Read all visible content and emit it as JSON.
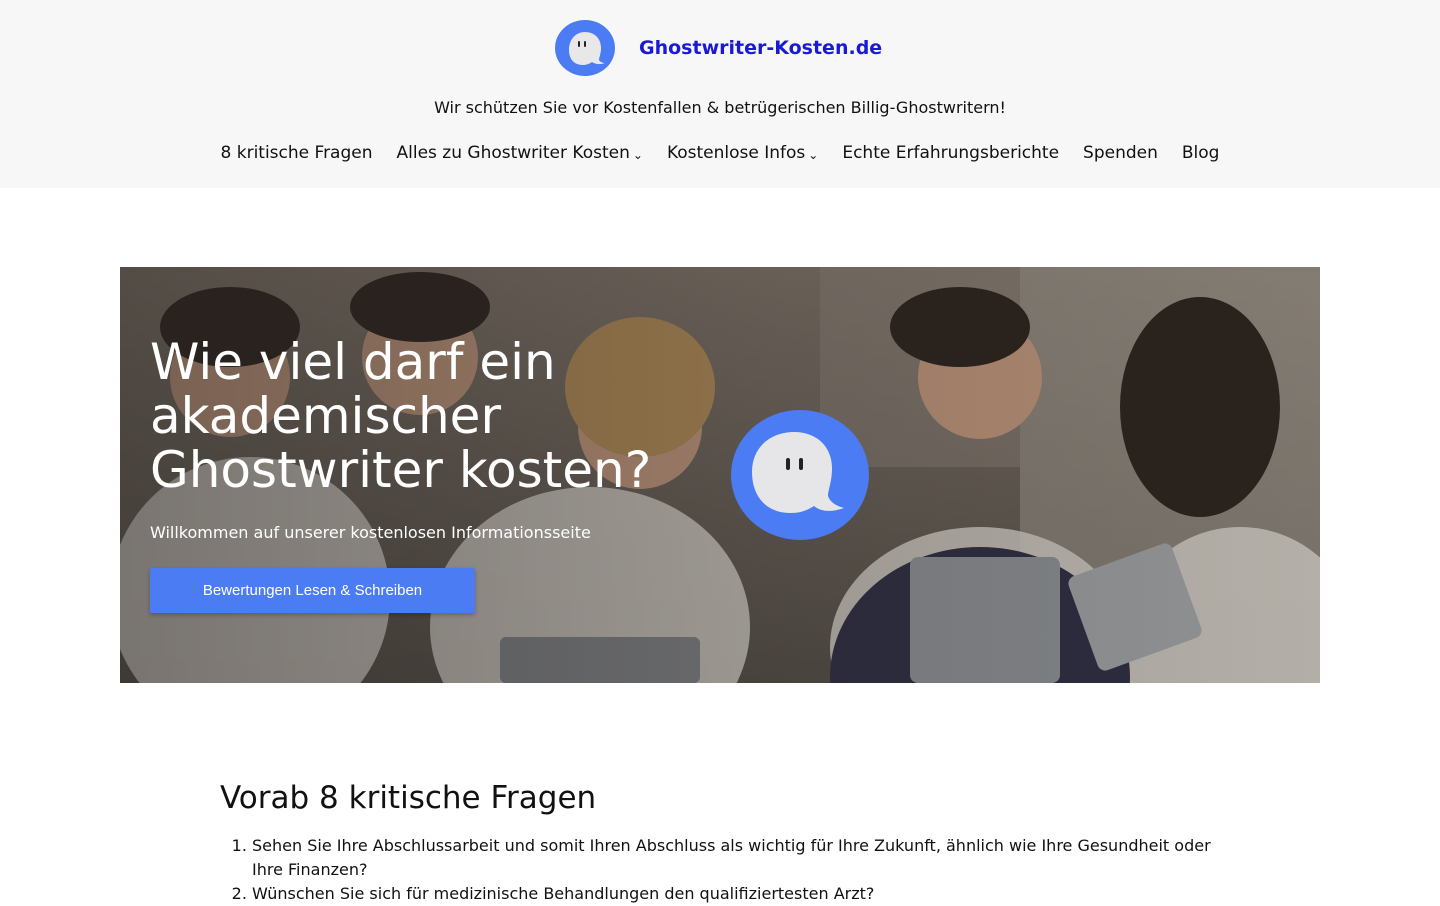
{
  "header": {
    "site_title": "Ghostwriter-Kosten.de",
    "tagline": "Wir schützen Sie vor Kostenfallen & betrügerischen Billig-Ghostwritern!",
    "logo_icon": "ghost-speech-bubble-icon",
    "brand_color": "#1a1ad6"
  },
  "nav": {
    "items": [
      {
        "label": "8 kritische Fragen"
      },
      {
        "label": "Alles zu Ghostwriter Kosten",
        "dropdown": "⌄"
      },
      {
        "label": "Kostenlose Infos",
        "dropdown": "⌄"
      },
      {
        "label": "Echte Erfahrungsberichte"
      },
      {
        "label": "Spenden"
      },
      {
        "label": "Blog"
      }
    ]
  },
  "hero": {
    "title": "Wie viel darf ein akademischer Ghostwriter kosten?",
    "subtitle": "Willkommen auf unserer kostenlosen Informationsseite",
    "button_label": "Bewertungen Lesen & Schreiben",
    "button_color": "#4b7cf3"
  },
  "content": {
    "heading": "Vorab 8 kritische Fragen",
    "questions": [
      "Sehen Sie Ihre Abschlussarbeit und somit Ihren Abschluss als wichtig für Ihre Zukunft, ähnlich wie Ihre Gesundheit oder Ihre Finanzen?",
      "Wünschen Sie sich für medizinische Behandlungen den qualifiziertesten Arzt?"
    ]
  }
}
